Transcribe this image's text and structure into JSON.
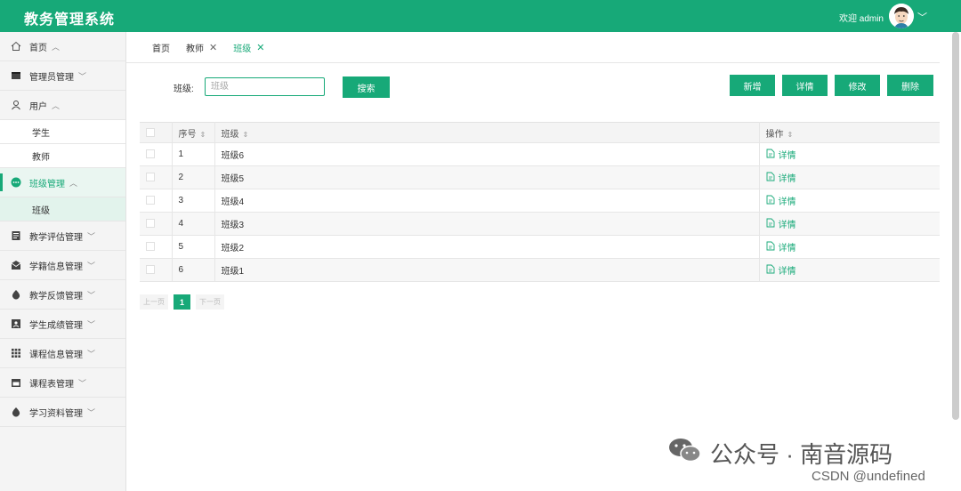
{
  "header": {
    "title": "教务管理系统",
    "welcome": "欢迎 admin"
  },
  "sidebar": {
    "items": [
      {
        "label": "首页",
        "icon": "home-icon"
      },
      {
        "label": "管理员管理",
        "icon": "admin-icon"
      },
      {
        "label": "用户",
        "icon": "user-icon",
        "children": [
          "学生",
          "教师"
        ]
      },
      {
        "label": "班级管理",
        "icon": "class-icon",
        "children": [
          "班级"
        ]
      },
      {
        "label": "教学评估管理",
        "icon": "evaluation-icon"
      },
      {
        "label": "学籍信息管理",
        "icon": "mail-icon"
      },
      {
        "label": "教学反馈管理",
        "icon": "feedback-icon"
      },
      {
        "label": "学生成绩管理",
        "icon": "grade-icon"
      },
      {
        "label": "课程信息管理",
        "icon": "grid-icon"
      },
      {
        "label": "课程表管理",
        "icon": "schedule-icon"
      },
      {
        "label": "学习资料管理",
        "icon": "material-icon"
      }
    ]
  },
  "tabs": [
    "首页",
    "教师",
    "班级"
  ],
  "search": {
    "label": "班级:",
    "placeholder": "班级",
    "button": "搜索"
  },
  "actions": {
    "add": "新增",
    "detail": "详情",
    "edit": "修改",
    "delete": "删除"
  },
  "table": {
    "headers": [
      "序号",
      "班级",
      "操作"
    ],
    "rows": [
      {
        "no": "1",
        "name": "班级6",
        "action": "详情"
      },
      {
        "no": "2",
        "name": "班级5",
        "action": "详情"
      },
      {
        "no": "3",
        "name": "班级4",
        "action": "详情"
      },
      {
        "no": "4",
        "name": "班级3",
        "action": "详情"
      },
      {
        "no": "5",
        "name": "班级2",
        "action": "详情"
      },
      {
        "no": "6",
        "name": "班级1",
        "action": "详情"
      }
    ]
  },
  "pager": {
    "prev": "上一页",
    "current": "1",
    "next": "下一页"
  },
  "watermark": {
    "text": "公众号 · 南音源码",
    "csdn": "CSDN @undefined"
  },
  "colors": {
    "brand": "#17a978"
  }
}
